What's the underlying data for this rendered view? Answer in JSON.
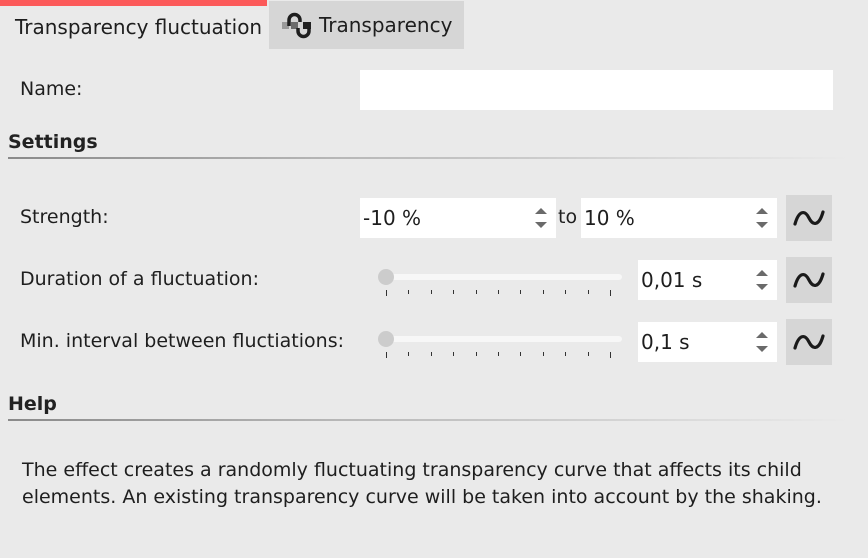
{
  "tabs": [
    {
      "label": "Transparency fluctuation",
      "active": true
    },
    {
      "label": "Transparency",
      "active": false,
      "icon": "transparency-curve-icon"
    }
  ],
  "colors": {
    "active_tab_indicator": "#fc5a5a",
    "background": "#eaeaea",
    "button_bg": "#d6d6d6"
  },
  "name_field": {
    "label": "Name:",
    "value": ""
  },
  "settings": {
    "title": "Settings",
    "strength": {
      "label": "Strength:",
      "from_value": "-10 %",
      "to_label": "to",
      "to_value": "10 %",
      "random_icon": "wave-icon"
    },
    "duration": {
      "label": "Duration of a fluctuation:",
      "slider_fraction": 0.0,
      "value": "0,01 s",
      "random_icon": "wave-icon"
    },
    "interval": {
      "label": "Min. interval between fluctiations:",
      "slider_fraction": 0.0,
      "value": "0,1 s",
      "random_icon": "wave-icon"
    }
  },
  "help": {
    "title": "Help",
    "text": "The effect creates a randomly fluctuating transparency curve that affects its child elements. An existing transparency curve will be taken into account by the shaking."
  }
}
